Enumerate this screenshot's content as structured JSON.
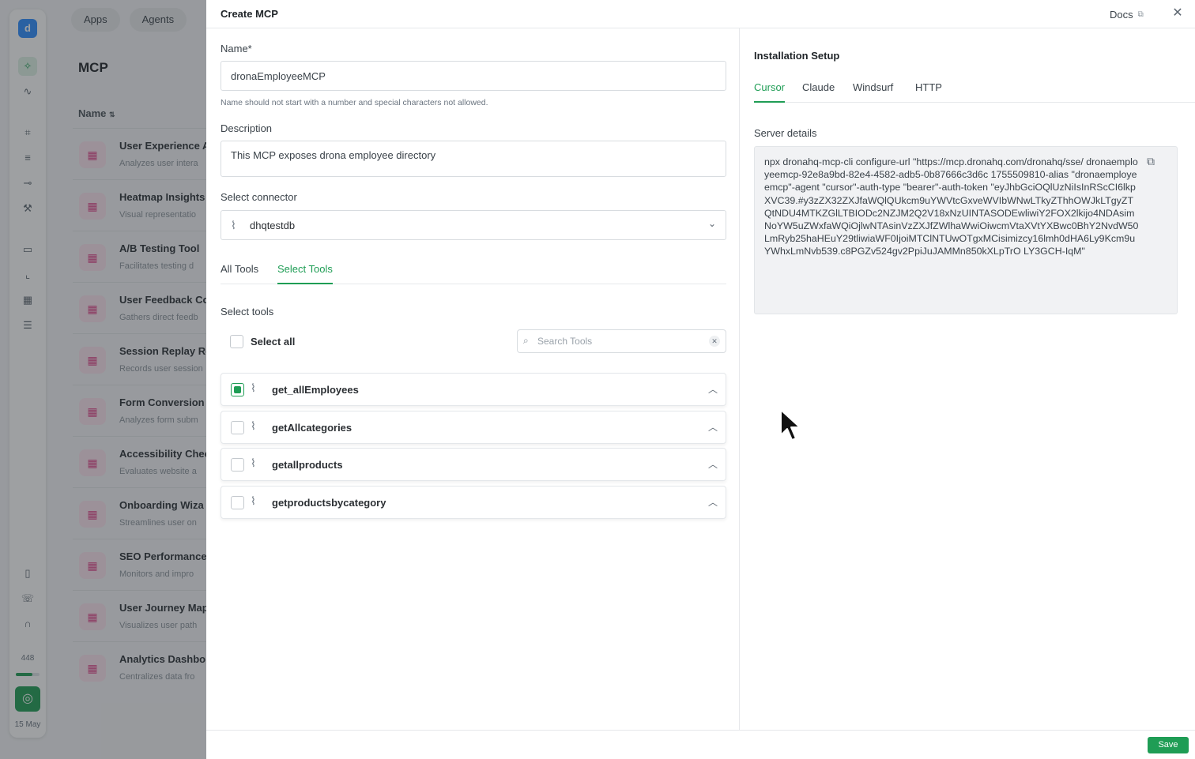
{
  "background": {
    "top_pills": [
      "Apps",
      "Agents"
    ],
    "page_title": "MCP",
    "column_header": "Name",
    "sort_icon": "sort-icon",
    "rail": {
      "count": "448",
      "usage_fraction": 0.7,
      "date": "15 May"
    },
    "list": [
      {
        "title": "User Experience A",
        "sub": "Analyzes user intera"
      },
      {
        "title": "Heatmap Insights",
        "sub": "Visual representatio"
      },
      {
        "title": "A/B Testing Tool",
        "sub": "Facilitates testing d"
      },
      {
        "title": "User Feedback Co",
        "sub": "Gathers direct feedb"
      },
      {
        "title": "Session Replay Re",
        "sub": "Records user session"
      },
      {
        "title": "Form Conversion",
        "sub": "Analyzes form subm"
      },
      {
        "title": "Accessibility Chec",
        "sub": "Evaluates website a"
      },
      {
        "title": "Onboarding Wiza",
        "sub": "Streamlines user on"
      },
      {
        "title": "SEO Performance",
        "sub": "Monitors and impro"
      },
      {
        "title": "User Journey Map",
        "sub": "Visualizes user path"
      },
      {
        "title": "Analytics Dashbo",
        "sub": "Centralizes data fro"
      }
    ]
  },
  "modal": {
    "title": "Create MCP",
    "docs_label": "Docs",
    "name_label": "Name*",
    "name_value": "dronaEmployeeMCP",
    "name_help": "Name should not start with a number and special characters not allowed.",
    "description_label": "Description",
    "description_value": "This MCP exposes drona employee directory",
    "connector_label": "Select connector",
    "connector_value": "dhqtestdb",
    "tabs": [
      "All Tools",
      "Select Tools"
    ],
    "active_tab": "Select Tools",
    "select_tools_label": "Select tools",
    "select_all_label": "Select all",
    "search_placeholder": "Search Tools",
    "tools": [
      {
        "name": "get_allEmployees",
        "checked": true
      },
      {
        "name": "getAllcategories",
        "checked": false
      },
      {
        "name": "getallproducts",
        "checked": false
      },
      {
        "name": "getproductsbycategory",
        "checked": false
      }
    ],
    "installation": {
      "title": "Installation Setup",
      "tabs": [
        "Cursor",
        "Claude",
        "Windsurf",
        "HTTP"
      ],
      "active_tab": "Cursor",
      "server_label": "Server details",
      "server_command": "npx dronahq-mcp-cli configure-url \"https://mcp.dronahq.com/dronahq/sse/ dronaemployeemcp-92e8a9bd-82e4-4582-adb5-0b87666c3d6c 1755509810-alias \"dronaemployeemcp\"-agent \"cursor\"-auth-type \"bearer\"-auth-token \"eyJhbGciOQlUzNiIsInRScCI6lkpXVC39.#y3zZX32ZXJfaWQlQUkcm9uYWVtcGxveWVIbWNwLTkyZThhOWJkLTgyZTQtNDU4MTKZGlLTBIODc2NZJM2Q2V18xNzUINTASODEwliwiY2FOX2lkijo4NDAsimNoYW5uZWxfaWQiOjlwNTAsinVzZXJfZWlhaWwiOiwcmVtaXVtYXBwc0BhY2NvdW50LmRyb25haHEuY29tliwiaWF0IjoiMTClNTUwOTgxMCisimizcy16lmh0dHA6Ly9Kcm9uYWhxLmNvb539.c8PGZv524gv2PpiJuJAMMn850kXLpTrO LY3GCH-IqM\""
    },
    "save_label": "Save"
  },
  "colors": {
    "accent": "#1f9d55",
    "tool_icon": "#e0478c",
    "logo": "#2d8cff"
  }
}
